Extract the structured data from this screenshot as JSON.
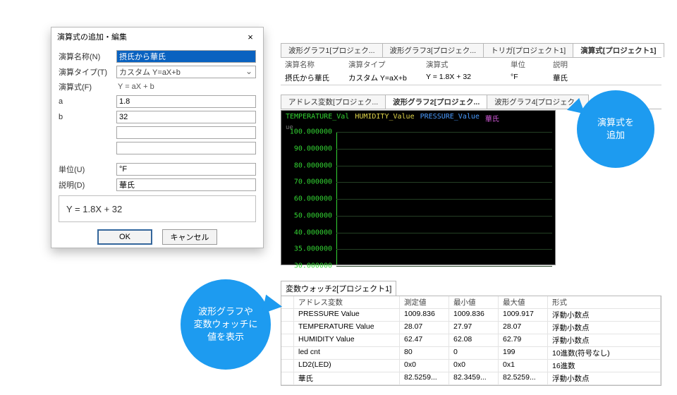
{
  "dialog": {
    "title": "演算式の追加・編集",
    "labels": {
      "name": "演算名称(N)",
      "type": "演算タイプ(T)",
      "formula": "演算式(F)",
      "a": "a",
      "b": "b",
      "unit": "単位(U)",
      "desc": "説明(D)"
    },
    "values": {
      "name": "摂氏から華氏",
      "type": "カスタム Y=aX+b",
      "formula": "Y = aX + b",
      "a": "1.8",
      "b": "32",
      "unit": "°F",
      "desc": "華氏",
      "preview": "Y = 1.8X + 32"
    },
    "buttons": {
      "ok": "OK",
      "cancel": "キャンセル"
    }
  },
  "topTabs": {
    "items": [
      "波形グラフ1[プロジェク...",
      "波形グラフ3[プロジェク...",
      "トリガ[プロジェクト1]",
      "演算式[プロジェクト1]"
    ],
    "activeIndex": 3
  },
  "calcTable": {
    "headers": [
      "演算名称",
      "演算タイプ",
      "演算式",
      "単位",
      "説明"
    ],
    "row": [
      "摂氏から華氏",
      "カスタム Y=aX+b",
      "Y = 1.8X + 32",
      "°F",
      "華氏"
    ]
  },
  "midTabs": {
    "items": [
      "アドレス変数[プロジェク...",
      "波形グラフ2[プロジェク...",
      "波形グラフ4[プロジェク..."
    ],
    "activeIndex": 1
  },
  "graph": {
    "legend": {
      "temperature": "TEMPERATURE_Val",
      "humidity": "HUMIDITY_Value",
      "pressure": "PRESSURE_Value",
      "fahrenheit": "華氏"
    },
    "ue": "ue",
    "yTicks": [
      "100.000000",
      "90.000000",
      "80.000000",
      "70.000000",
      "60.000000",
      "50.000000",
      "40.000000",
      "35.000000",
      "30.000000"
    ]
  },
  "watch": {
    "title": "変数ウォッチ2[プロジェクト1]",
    "headers": [
      "",
      "アドレス変数",
      "測定値",
      "最小値",
      "最大値",
      "形式"
    ],
    "rows": [
      {
        "name": "PRESSURE Value",
        "v": "1009.836",
        "min": "1009.836",
        "max": "1009.917",
        "fmt": "浮動小数点"
      },
      {
        "name": "TEMPERATURE Value",
        "v": "28.07",
        "min": "27.97",
        "max": "28.07",
        "fmt": "浮動小数点"
      },
      {
        "name": "HUMIDITY Value",
        "v": "62.47",
        "min": "62.08",
        "max": "62.79",
        "fmt": "浮動小数点"
      },
      {
        "name": "led cnt",
        "v": "80",
        "min": "0",
        "max": "199",
        "fmt": "10進数(符号なし)"
      },
      {
        "name": "LD2(LED)",
        "v": "0x0",
        "min": "0x0",
        "max": "0x1",
        "fmt": "16進数"
      },
      {
        "name": "華氏",
        "v": "82.5259...",
        "min": "82.3459...",
        "max": "82.5259...",
        "fmt": "浮動小数点"
      }
    ]
  },
  "callouts": {
    "add": "演算式を\n追加",
    "show": "波形グラフや\n変数ウォッチに\n値を表示"
  }
}
